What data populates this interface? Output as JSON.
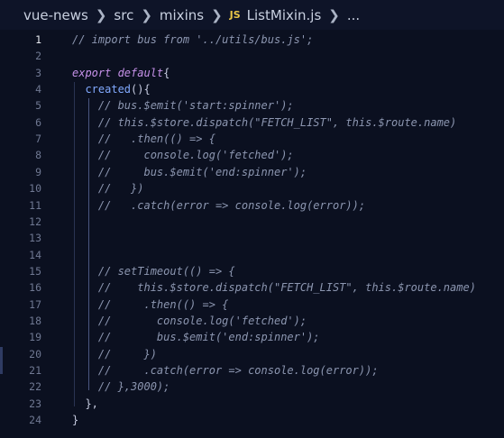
{
  "breadcrumb": {
    "items": [
      "vue-news",
      "src",
      "mixins",
      "ListMixin.js",
      "..."
    ],
    "file_icon": "JS"
  },
  "editor": {
    "lines": [
      {
        "n": "1",
        "parts": [
          {
            "t": "// import bus from '../utils/bus.js';",
            "c": "cm"
          }
        ]
      },
      {
        "n": "2",
        "parts": []
      },
      {
        "n": "3",
        "parts": [
          {
            "t": "export default",
            "c": "kw"
          },
          {
            "t": "{",
            "c": "punc"
          }
        ]
      },
      {
        "n": "4",
        "parts": [
          {
            "t": "  ",
            "c": "punc"
          },
          {
            "t": "created",
            "c": "fn"
          },
          {
            "t": "(){",
            "c": "punc"
          }
        ]
      },
      {
        "n": "5",
        "parts": [
          {
            "t": "    // bus.$emit('start:spinner');",
            "c": "cm"
          }
        ]
      },
      {
        "n": "6",
        "parts": [
          {
            "t": "    // this.$store.dispatch(\"FETCH_LIST\", this.$route.name)",
            "c": "cm"
          }
        ]
      },
      {
        "n": "7",
        "parts": [
          {
            "t": "    //   .then(() => {",
            "c": "cm"
          }
        ]
      },
      {
        "n": "8",
        "parts": [
          {
            "t": "    //     console.log('fetched');",
            "c": "cm"
          }
        ]
      },
      {
        "n": "9",
        "parts": [
          {
            "t": "    //     bus.$emit('end:spinner');",
            "c": "cm"
          }
        ]
      },
      {
        "n": "10",
        "parts": [
          {
            "t": "    //   })",
            "c": "cm"
          }
        ]
      },
      {
        "n": "11",
        "parts": [
          {
            "t": "    //   .catch(error => console.log(error));",
            "c": "cm"
          }
        ]
      },
      {
        "n": "12",
        "parts": []
      },
      {
        "n": "13",
        "parts": []
      },
      {
        "n": "14",
        "parts": []
      },
      {
        "n": "15",
        "parts": [
          {
            "t": "    // setTimeout(() => {",
            "c": "cm"
          }
        ]
      },
      {
        "n": "16",
        "parts": [
          {
            "t": "    //    this.$store.dispatch(\"FETCH_LIST\", this.$route.name)",
            "c": "cm"
          }
        ]
      },
      {
        "n": "17",
        "parts": [
          {
            "t": "    //     .then(() => {",
            "c": "cm"
          }
        ]
      },
      {
        "n": "18",
        "parts": [
          {
            "t": "    //       console.log('fetched');",
            "c": "cm"
          }
        ]
      },
      {
        "n": "19",
        "parts": [
          {
            "t": "    //       bus.$emit('end:spinner');",
            "c": "cm"
          }
        ]
      },
      {
        "n": "20",
        "parts": [
          {
            "t": "    //     })",
            "c": "cm"
          }
        ]
      },
      {
        "n": "21",
        "parts": [
          {
            "t": "    //     .catch(error => console.log(error));",
            "c": "cm"
          }
        ]
      },
      {
        "n": "22",
        "parts": [
          {
            "t": "    // },3000);",
            "c": "cm"
          }
        ]
      },
      {
        "n": "23",
        "parts": [
          {
            "t": "  },",
            "c": "punc"
          }
        ]
      },
      {
        "n": "24",
        "parts": [
          {
            "t": "}",
            "c": "punc"
          }
        ]
      }
    ],
    "current_line": "1"
  },
  "colors": {
    "background": "#0b1020",
    "keyword": "#c792ea",
    "function": "#82aaff",
    "comment": "#8c96b0",
    "js_icon": "#e8c547"
  }
}
